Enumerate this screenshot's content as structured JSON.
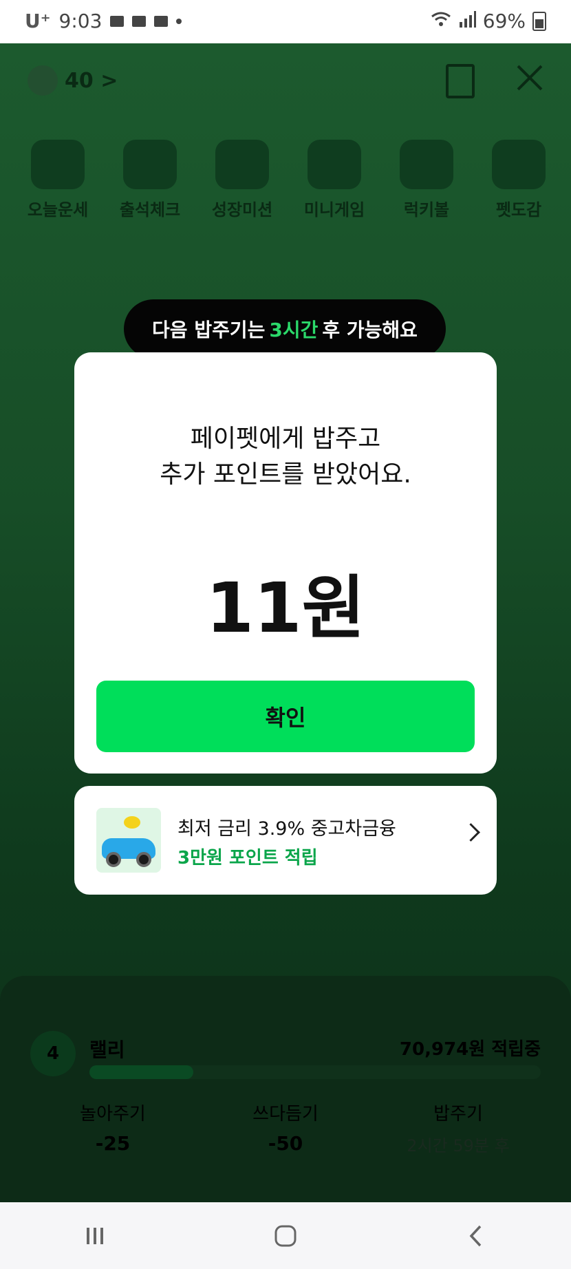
{
  "status_bar": {
    "carrier": "U⁺",
    "time": "9:03",
    "battery": "69%"
  },
  "app": {
    "paw_points": "40 >",
    "menu": [
      {
        "label": "오늘운세"
      },
      {
        "label": "출석체크"
      },
      {
        "label": "성장미션"
      },
      {
        "label": "미니게임"
      },
      {
        "label": "럭키볼"
      },
      {
        "label": "펫도감"
      }
    ],
    "pet": {
      "level": "4",
      "name": "랠리",
      "accumulated": "70,974원 적립중",
      "progress": 0.23
    },
    "actions": [
      {
        "label": "놀아주기",
        "value": "-25"
      },
      {
        "label": "쓰다듬기",
        "value": "-50"
      },
      {
        "label": "밥주기",
        "sub": "2시간 59분 후"
      }
    ]
  },
  "tooltip": {
    "prefix": "다음 밥주기는",
    "highlight": "3시간",
    "suffix": "후 가능해요"
  },
  "dialog": {
    "message_line1": "페이펫에게 밥주고",
    "message_line2": "추가 포인트를 받았어요.",
    "amount": "11원",
    "confirm_label": "확인"
  },
  "ad": {
    "line1": "최저 금리 3.9% 중고차금융",
    "line2": "3만원 포인트 적립"
  },
  "colors": {
    "accent_green": "#00de5a",
    "highlight_green": "#2bd96a",
    "ad_green": "#0aa54a"
  }
}
